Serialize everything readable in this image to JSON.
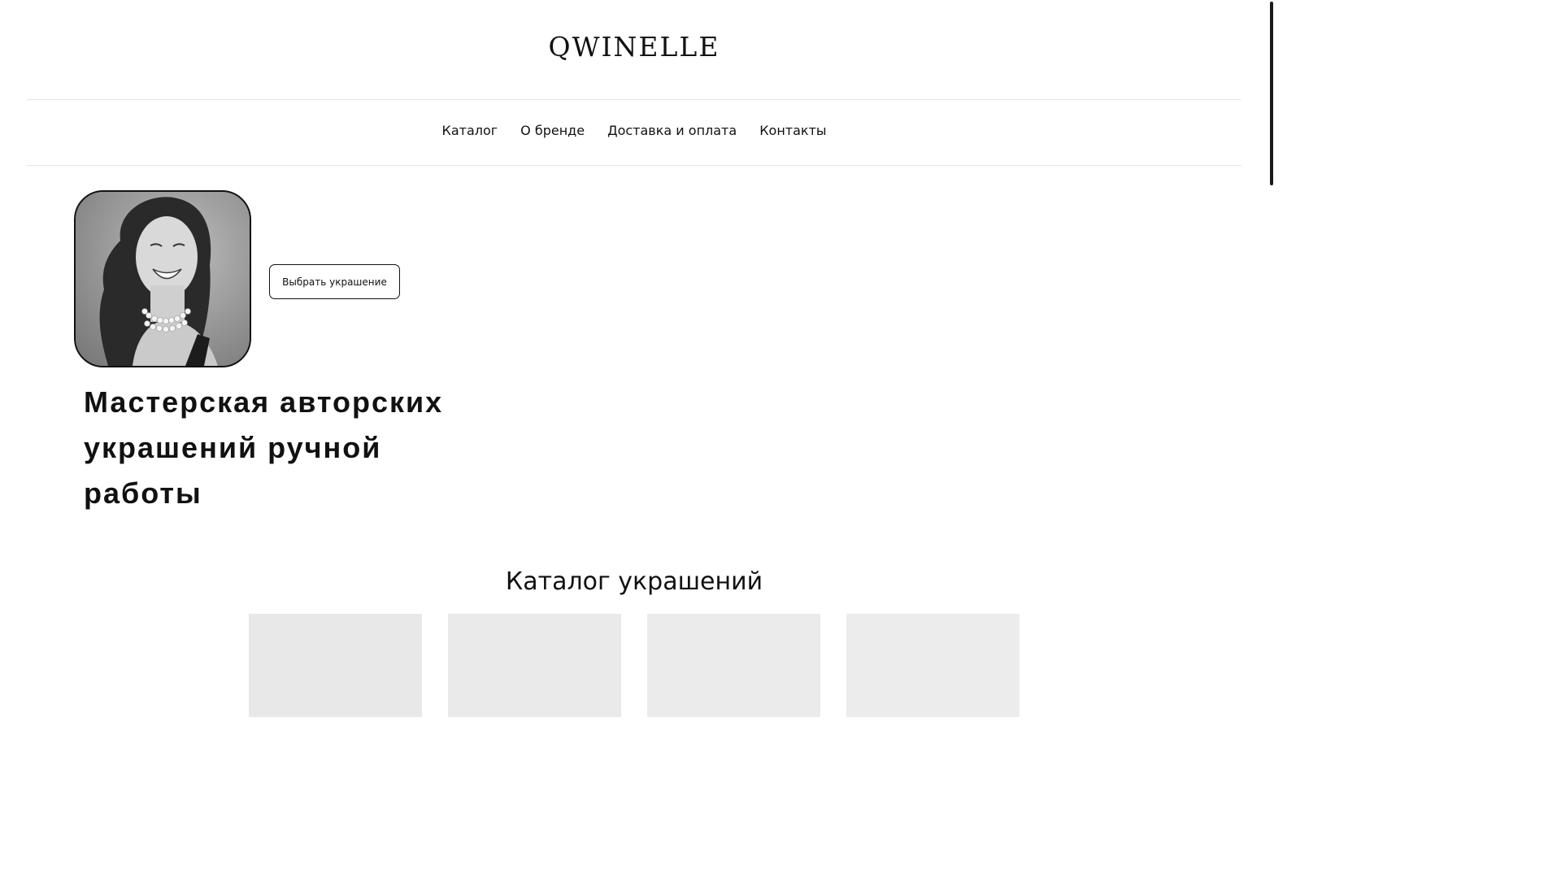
{
  "header": {
    "logo": "QWINELLE"
  },
  "nav": {
    "items": [
      {
        "label": "Каталог"
      },
      {
        "label": "О бренде"
      },
      {
        "label": "Доставка и оплата"
      },
      {
        "label": "Контакты"
      }
    ]
  },
  "hero": {
    "cta_label": "Выбрать украшение",
    "title": "Мастерская авторских украшений ручной работы"
  },
  "catalog": {
    "title": "Каталог украшений",
    "cards_count": 4
  },
  "colors": {
    "text": "#111111",
    "divider": "#e6e6e6",
    "card_placeholder": "#e8e8e8"
  }
}
